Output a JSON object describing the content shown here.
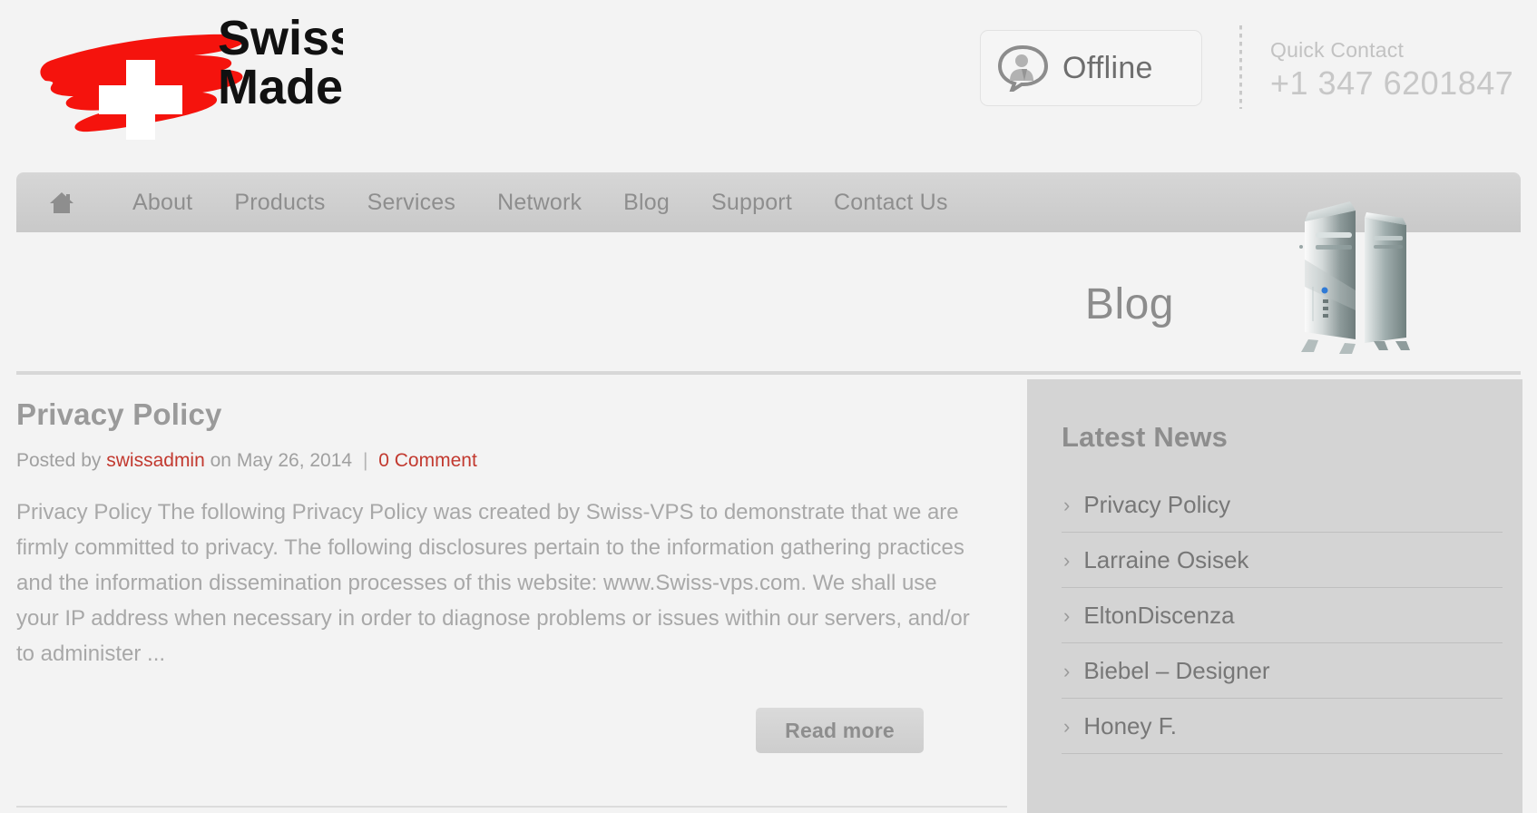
{
  "header": {
    "logo": {
      "line1": "Swiss",
      "line2": "Made",
      "alt": "swiss-made-logo",
      "flag_color": "#f5130d"
    },
    "chat_status_button": {
      "label": "Offline",
      "icon": "chat-person-icon"
    },
    "quick_contact": {
      "label": "Quick Contact",
      "phone": "+1 347 6201847"
    }
  },
  "nav": {
    "home_icon": "home-icon",
    "items": [
      {
        "label": "About"
      },
      {
        "label": "Products"
      },
      {
        "label": "Services"
      },
      {
        "label": "Network"
      },
      {
        "label": "Blog"
      },
      {
        "label": "Support"
      },
      {
        "label": "Contact Us"
      }
    ]
  },
  "banner": {
    "title": "Blog",
    "image": "server-towers-image"
  },
  "article": {
    "title": "Privacy Policy",
    "meta": {
      "posted_by_label": "Posted by",
      "author": "swissadmin",
      "on_label": "on",
      "date": "May 26, 2014",
      "separator": "|",
      "comments": "0 Comment"
    },
    "body": "Privacy Policy The following Privacy Policy was created by Swiss-VPS to demonstrate that we are firmly committed to privacy. The following disclosures pertain to the information gathering practices and the information dissemination processes of this website: www.Swiss-vps.com. We shall use your IP address when necessary in order to diagnose problems or issues within our servers, and/or to administer ...",
    "read_more_label": "Read more"
  },
  "sidebar": {
    "title": "Latest News",
    "items": [
      {
        "label": "Privacy Policy"
      },
      {
        "label": "Larraine Osisek"
      },
      {
        "label": "EltonDiscenza"
      },
      {
        "label": "Biebel – Designer"
      },
      {
        "label": "Honey F."
      }
    ],
    "chevron": "›"
  },
  "colors": {
    "accent_red": "#c2392f",
    "page_bg": "#f3f3f3",
    "nav_bg": "#d1d1d1",
    "sidebar_bg": "#d4d4d4"
  }
}
